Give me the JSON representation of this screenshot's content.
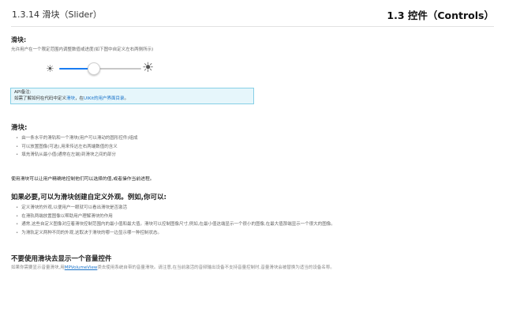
{
  "header": {
    "section_left": "1.3.14   滑块（Slider）",
    "section_right": "1.3   控件（Controls）"
  },
  "intro": {
    "title": "滑块:",
    "description": "允许用户在一个限定范围内调整数值或进度(如下图中自定义左右两侧所示)"
  },
  "slider_demo": {
    "min_icon": "sun-small-icon",
    "max_icon": "sun-large-icon",
    "value_fraction": 0.42,
    "track_color": "#1a7cf2"
  },
  "api_note": {
    "title": "API备注:",
    "prefix": "如需了解如何在代码中定义",
    "link1": "滑块",
    "middle": "，在",
    "link2": "UIKit的用户界面目录",
    "suffix": "。"
  },
  "section_slider": {
    "title": "滑块:",
    "items": [
      "由一条水平的滑轨和一个滑块(用户可以滑动的圆形控件)组成",
      "可以放置图像(可选),用来传达左右两端数值的含义",
      "填充滑轨从最小值(通常在左端)到滑块之间的部分"
    ]
  },
  "paragraph": "使用滑块可以让用户精确地控制他们可以选择的值,或者操作当前进程。",
  "section_custom": {
    "title": "如果必要,可以为滑块创建自定义外观。例如,你可以:",
    "items": [
      "定义滑块的外观,以便用户一眼就可以看出滑块是否激活",
      "在滑轨两端放置图像以帮助用户理解滑块的作用",
      "通常,这些自定义图像对应着滑块控制范围内的最小值和最大值。滑块可以控制图像尺寸,例如,在最小值这端显示一个很小的图像,在最大值那端显示一个很大的图像。",
      "为滑轨定义两种不同的外观,这取决于滑块的哪一边显示哪一种控制状态。"
    ]
  },
  "section_volume": {
    "title": "不要使用滑块去显示一个音量控件",
    "prefix": "如果你需要显示音量滑块,用",
    "link": "MPVolumeView",
    "suffix": "类去使用系统自带的音量滑块。请注意,在当前激活的音频输出设备不支持音量控制时,音量滑块会被替换为适当的设备名称。"
  }
}
